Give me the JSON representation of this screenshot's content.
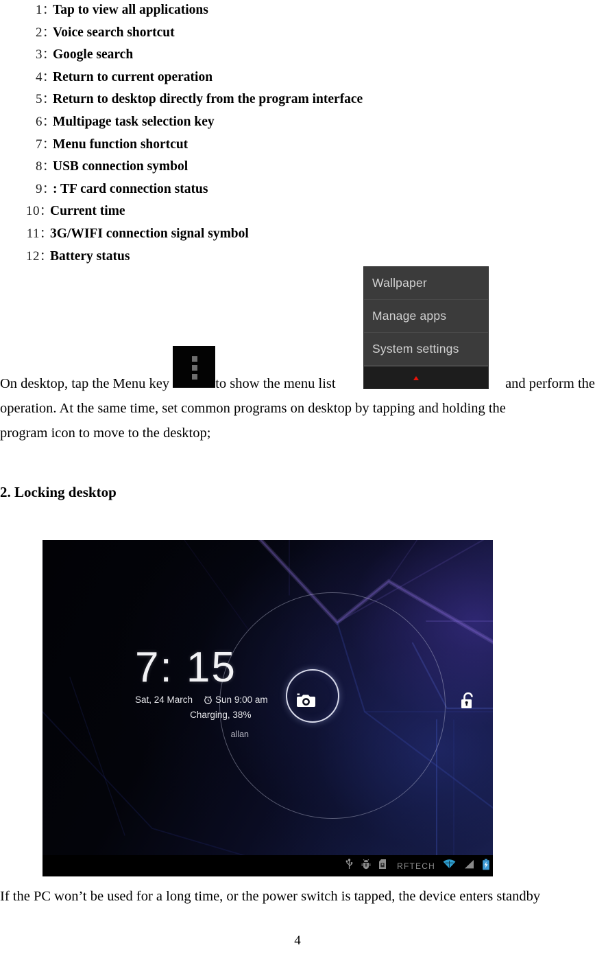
{
  "legend": {
    "separator": "：",
    "separator_alt": "：",
    "items": [
      {
        "num": "1",
        "sep": "：",
        "label": "Tap to view all applications"
      },
      {
        "num": "2",
        "sep": "：",
        "label": "Voice search shortcut"
      },
      {
        "num": "3",
        "sep": "：",
        "label": " Google search"
      },
      {
        "num": "4",
        "sep": "：",
        "label": "Return to current operation"
      },
      {
        "num": "5",
        "sep": "：",
        "label": "Return to desktop directly from the program interface"
      },
      {
        "num": "6",
        "sep": "：",
        "label": "Multipage task selection key"
      },
      {
        "num": "7",
        "sep": "：",
        "label": "Menu function shortcut"
      },
      {
        "num": "8",
        "sep": "：",
        "label": "USB connection symbol"
      },
      {
        "num": "9",
        "sep": "：",
        "label": ": TF card connection status"
      },
      {
        "num": "10",
        "sep": "：",
        "label": "Current time"
      },
      {
        "num": "11",
        "sep": "：",
        "label": "3G/WIFI connection signal symbol"
      },
      {
        "num": "12",
        "sep": "：",
        "label": "Battery status"
      }
    ]
  },
  "paragraph_1": {
    "line1_a": "On desktop, tap the Menu key ",
    "line1_b": "to show the menu list",
    "line1_c": "and perform the",
    "line2": "operation. At the same time, set common programs on desktop by tapping and holding the",
    "line3": "program icon to move to the desktop;"
  },
  "menu_popup": {
    "items": [
      "Wallpaper",
      "Manage apps",
      "System settings"
    ],
    "bg_color": "#3b3b3b",
    "text_color": "#d2d2d2",
    "marker_color": "#e81309"
  },
  "heading_2": "2. Locking desktop",
  "lockscreen": {
    "time": "7: 15",
    "date": "Sat, 24 March",
    "alarm": "Sun 9:00 am",
    "charging": "Charging, 38%",
    "owner": "allan",
    "icons": {
      "camera": "camera-icon",
      "unlock": "unlock-icon",
      "usb": "usb-icon",
      "debug": "android-debug-icon",
      "sdcard": "sd-card-icon",
      "wifi": "wifi-icon",
      "signal": "signal-icon",
      "battery": "battery-charging-icon"
    },
    "carrier": "RFTECH",
    "accent_wifi_color": "#2e9ecf",
    "accent_battery_color": "#3e9ad6"
  },
  "paragraph_2": {
    "line1": "If the PC won’t be used for a long time, or the power switch is tapped, the device enters standby"
  },
  "page_number": "4"
}
